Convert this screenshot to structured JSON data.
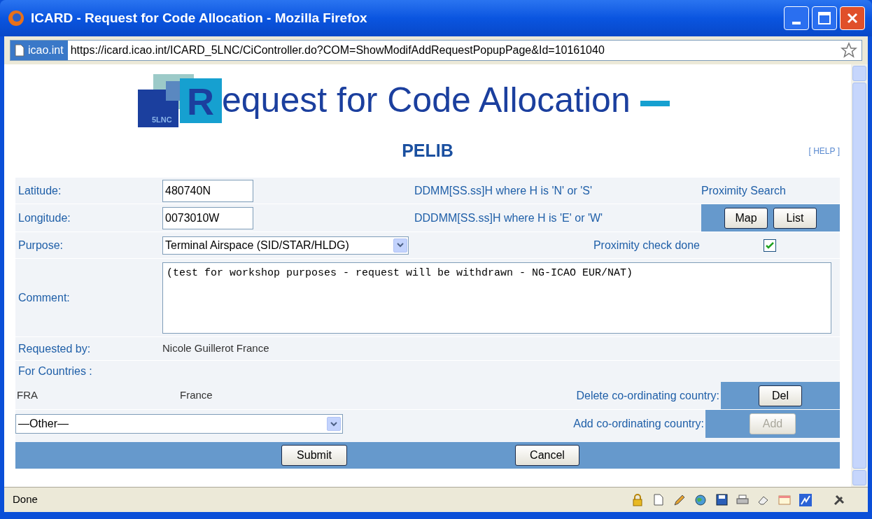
{
  "window": {
    "title": "ICARD - Request for Code Allocation - Mozilla Firefox"
  },
  "address_bar": {
    "site": "icao.int",
    "url": "https://icard.icao.int/ICARD_5LNC/CiController.do?COM=ShowModifAddRequestPopupPage&Id=10161040"
  },
  "header": {
    "logo_tag": "5LNC",
    "title_initial": "R",
    "title_rest": "equest for Code Allocation",
    "code": "PELIB",
    "help": "[ HELP ]"
  },
  "form": {
    "latitude": {
      "label": "Latitude:",
      "value": "480740N",
      "hint": "DDMM[SS.ss]H where H is 'N' or 'S'"
    },
    "longitude": {
      "label": "Longitude:",
      "value": "0073010W",
      "hint": "DDDMM[SS.ss]H where H is 'E' or 'W'"
    },
    "proximity_search": {
      "label": "Proximity Search",
      "buttons": [
        "Map",
        "List"
      ]
    },
    "purpose": {
      "label": "Purpose:",
      "value": "Terminal Airspace (SID/STAR/HLDG)"
    },
    "proximity_check": {
      "label": "Proximity check done",
      "checked": true
    },
    "comment": {
      "label": "Comment:",
      "value": "(test for workshop purposes - request will be withdrawn - NG-ICAO EUR/NAT)"
    },
    "requested_by": {
      "label": "Requested by:",
      "value": "Nicole Guillerot France"
    },
    "for_countries": {
      "label": "For Countries :",
      "rows": [
        {
          "code": "FRA",
          "name": "France"
        }
      ]
    },
    "delete_country": {
      "label": "Delete co-ordinating country:",
      "button": "Del",
      "disabled": false
    },
    "country_select": {
      "value": "—Other—"
    },
    "add_country": {
      "label": "Add co-ordinating country:",
      "button": "Add",
      "disabled": true
    },
    "actions": [
      "Submit",
      "Cancel"
    ]
  },
  "status_bar": {
    "text": "Done"
  }
}
